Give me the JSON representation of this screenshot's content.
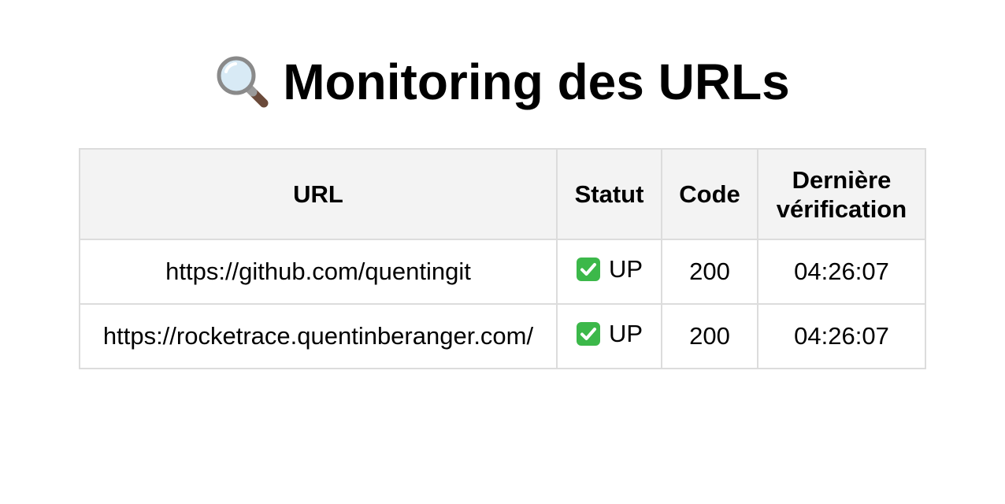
{
  "page": {
    "title": "Monitoring des URLs",
    "title_icon": "magnifying-glass-icon"
  },
  "table": {
    "headers": {
      "url": "URL",
      "status": "Statut",
      "code": "Code",
      "last_check": "Dernière vérification"
    },
    "rows": [
      {
        "url": "https://github.com/quentingit",
        "status_icon": "green-checkmark-icon",
        "status": "UP",
        "code": "200",
        "last_check": "04:26:07"
      },
      {
        "url": "https://rocketrace.quentinberanger.com/",
        "status_icon": "green-checkmark-icon",
        "status": "UP",
        "code": "200",
        "last_check": "04:26:07"
      }
    ]
  },
  "colors": {
    "header_background": "#f3f3f3",
    "border": "#dcdcdc",
    "status_up": "#3cb84a"
  }
}
